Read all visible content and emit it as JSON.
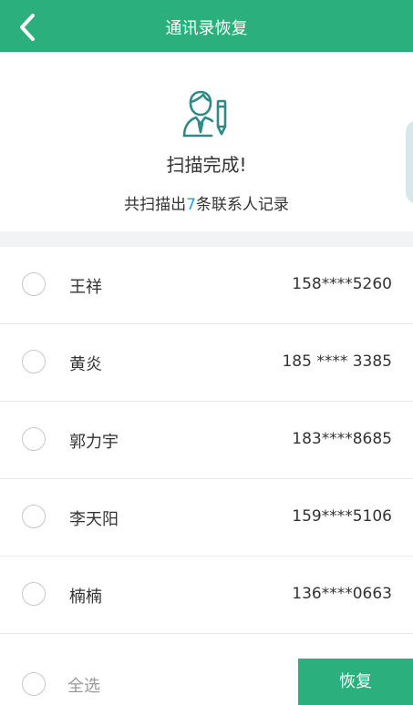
{
  "header": {
    "title": "通讯录恢复",
    "back_icon": "chevron-left-icon"
  },
  "scan": {
    "icon": "contact-person-icon",
    "title": "扫描完成!",
    "summary_prefix": "共扫描出",
    "summary_count": "7",
    "summary_suffix": "条联系人记录"
  },
  "contacts": [
    {
      "name": "王祥",
      "phone": "158****5260"
    },
    {
      "name": "黄炎",
      "phone": "185 **** 3385"
    },
    {
      "name": "郭力宇",
      "phone": "183****8685"
    },
    {
      "name": "李天阳",
      "phone": "159****5106"
    },
    {
      "name": "楠楠",
      "phone": "136****0663"
    }
  ],
  "footer": {
    "select_all": "全选",
    "restore_label": "恢复"
  },
  "colors": {
    "brand": "#2bb07d",
    "count_highlight": "#2aa0d6"
  }
}
